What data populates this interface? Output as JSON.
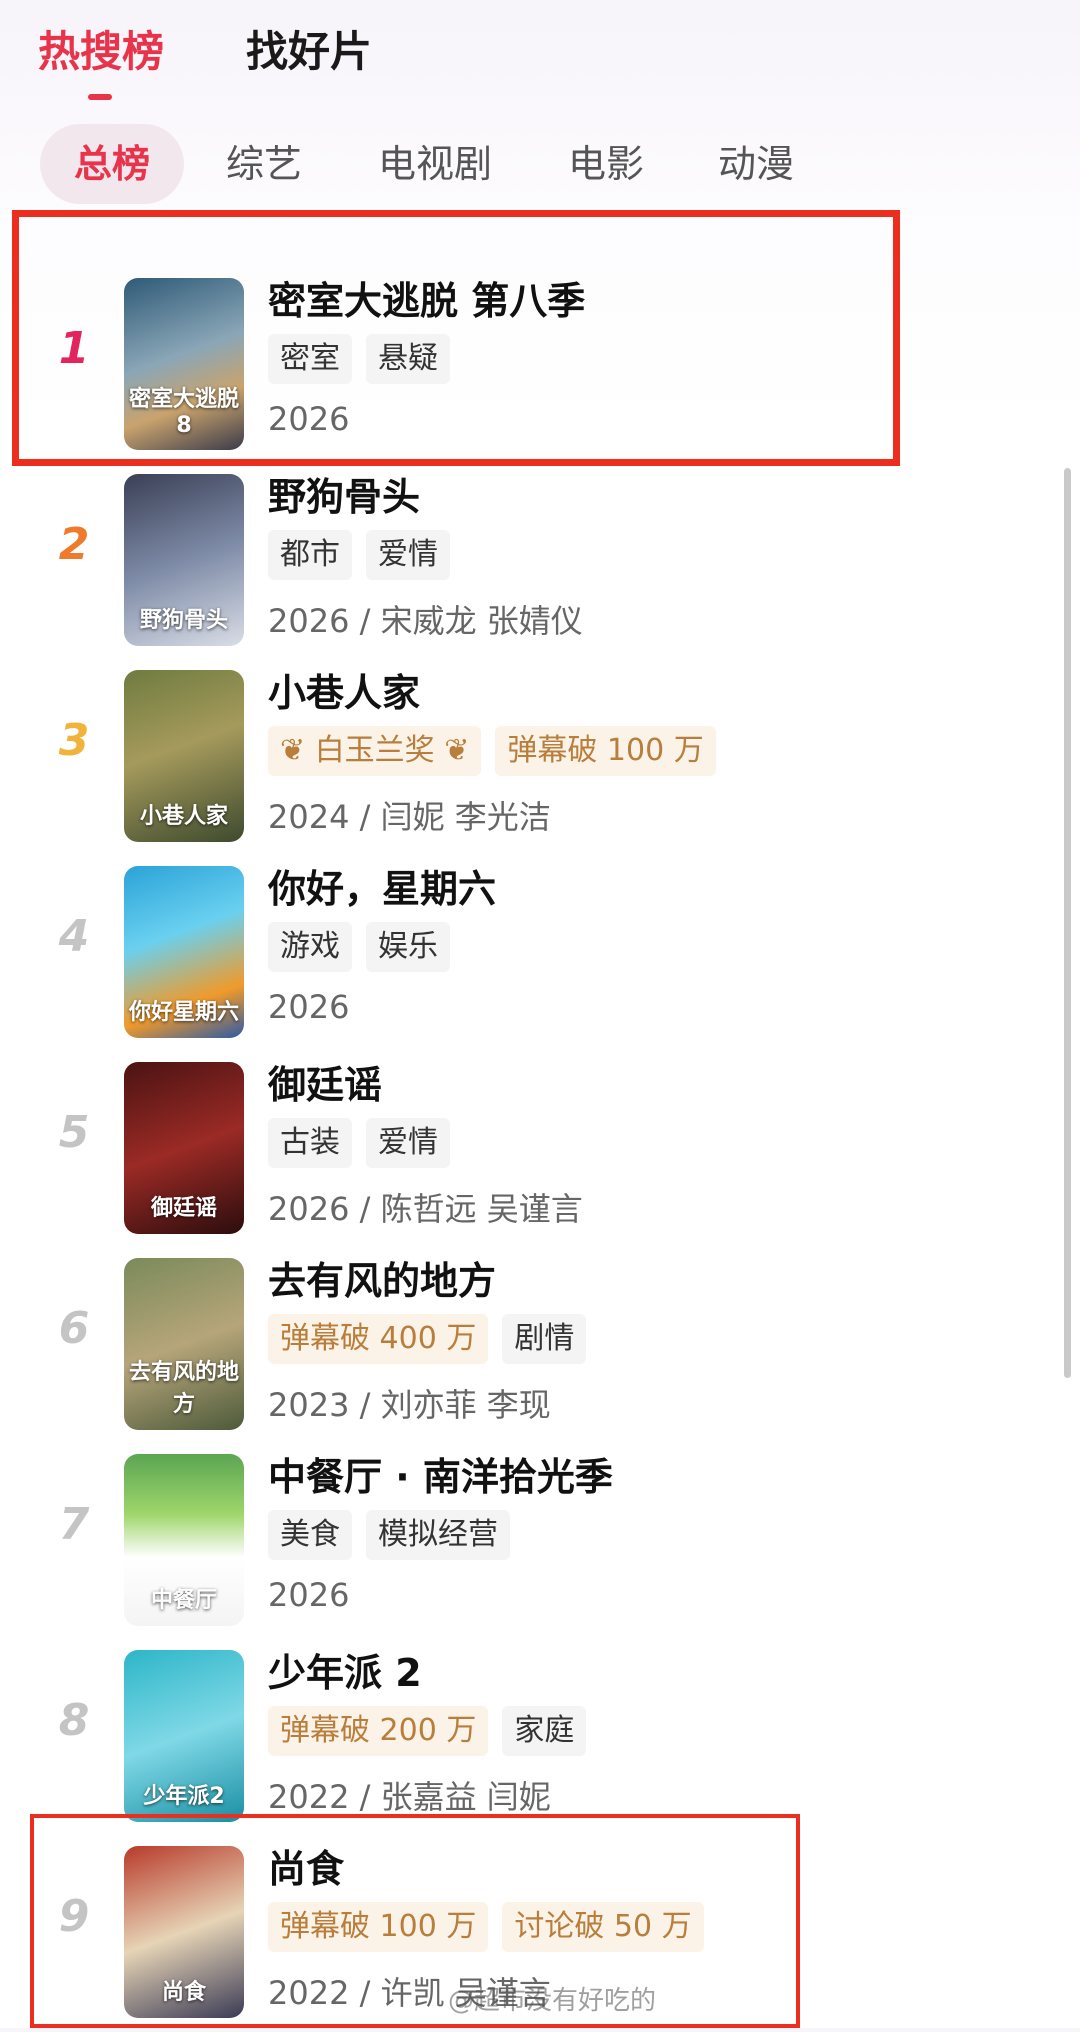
{
  "top_tabs": {
    "hot": "热搜榜",
    "discover": "找好片"
  },
  "categories": [
    "总榜",
    "综艺",
    "电视剧",
    "电影",
    "动漫"
  ],
  "items": [
    {
      "rank": "1",
      "title": "密室大逃脱 第八季",
      "poster_text": "密室大逃脱8",
      "tags": [
        {
          "text": "密室",
          "type": "plain"
        },
        {
          "text": "悬疑",
          "type": "plain"
        }
      ],
      "meta": "2026"
    },
    {
      "rank": "2",
      "title": "野狗骨头",
      "poster_text": "野狗骨头",
      "tags": [
        {
          "text": "都市",
          "type": "plain"
        },
        {
          "text": "爱情",
          "type": "plain"
        }
      ],
      "meta": "2026 / 宋威龙 张婧仪"
    },
    {
      "rank": "3",
      "title": "小巷人家",
      "poster_text": "小巷人家",
      "tags": [
        {
          "text": "白玉兰奖",
          "type": "award"
        },
        {
          "text": "弹幕破 100 万",
          "type": "hot"
        }
      ],
      "meta": "2024 / 闫妮 李光洁"
    },
    {
      "rank": "4",
      "title": "你好，星期六",
      "poster_text": "你好星期六",
      "tags": [
        {
          "text": "游戏",
          "type": "plain"
        },
        {
          "text": "娱乐",
          "type": "plain"
        }
      ],
      "meta": "2026"
    },
    {
      "rank": "5",
      "title": "御廷谣",
      "poster_text": "御廷谣",
      "tags": [
        {
          "text": "古装",
          "type": "plain"
        },
        {
          "text": "爱情",
          "type": "plain"
        }
      ],
      "meta": "2026 / 陈哲远 吴谨言"
    },
    {
      "rank": "6",
      "title": "去有风的地方",
      "poster_text": "去有风的地方",
      "tags": [
        {
          "text": "弹幕破 400 万",
          "type": "hot"
        },
        {
          "text": "剧情",
          "type": "plain"
        }
      ],
      "meta": "2023 / 刘亦菲 李现"
    },
    {
      "rank": "7",
      "title": "中餐厅 · 南洋拾光季",
      "poster_text": "中餐厅",
      "tags": [
        {
          "text": "美食",
          "type": "plain"
        },
        {
          "text": "模拟经营",
          "type": "plain"
        }
      ],
      "meta": "2026"
    },
    {
      "rank": "8",
      "title": "少年派 2",
      "poster_text": "少年派2",
      "tags": [
        {
          "text": "弹幕破 200 万",
          "type": "hot"
        },
        {
          "text": "家庭",
          "type": "plain"
        }
      ],
      "meta": "2022 / 张嘉益 闫妮"
    },
    {
      "rank": "9",
      "title": "尚食",
      "poster_text": "尚食",
      "tags": [
        {
          "text": "弹幕破 100 万",
          "type": "hot"
        },
        {
          "text": "讨论破 50 万",
          "type": "hot"
        }
      ],
      "meta": "2022 / 许凯 吴谨言"
    }
  ],
  "watermark": "@超市没有好吃的",
  "colors": {
    "accent": "#e8334a",
    "highlight_box": "#ec2e1f",
    "hot_tag_bg": "#fbf3e8",
    "hot_tag_text": "#b97e3b"
  }
}
